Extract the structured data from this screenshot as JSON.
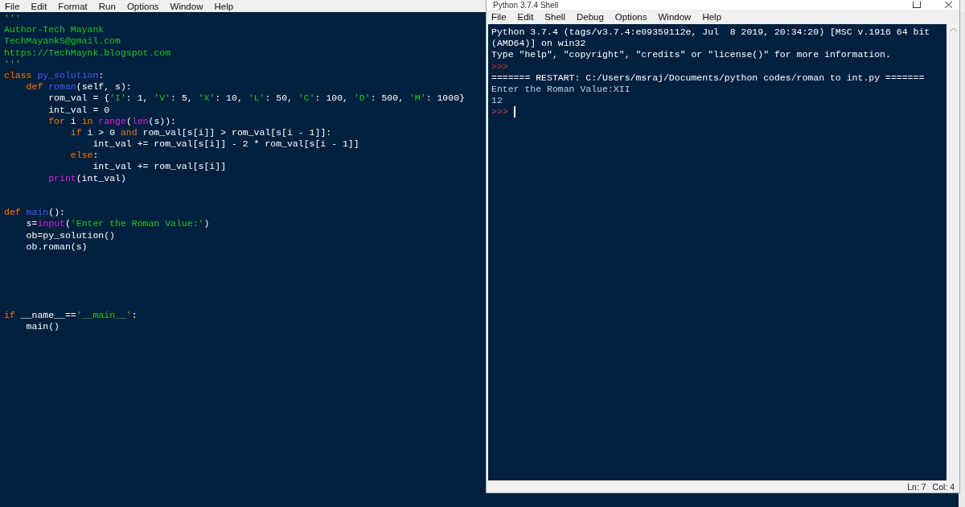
{
  "editor": {
    "menu": [
      "File",
      "Edit",
      "Format",
      "Run",
      "Options",
      "Window",
      "Help"
    ],
    "lines": [
      {
        "kind": "code",
        "tokens": [
          {
            "text": "'''",
            "kind": "string"
          }
        ]
      },
      {
        "kind": "code",
        "tokens": [
          {
            "text": "Author-Tech Mayank",
            "kind": "string"
          }
        ]
      },
      {
        "kind": "code",
        "tokens": [
          {
            "text": "TechMayankS@gmail.com",
            "kind": "string"
          }
        ]
      },
      {
        "kind": "code",
        "tokens": [
          {
            "text": "https://TechMaynk.blogspot.com",
            "kind": "string"
          }
        ]
      },
      {
        "kind": "code",
        "tokens": [
          {
            "text": "'''",
            "kind": "string"
          }
        ]
      },
      {
        "kind": "code",
        "tokens": [
          {
            "text": "class",
            "kind": "keyword"
          },
          {
            "text": " py_solution",
            "kind": "definition"
          },
          {
            "text": ":",
            "kind": "plain"
          }
        ]
      },
      {
        "kind": "code",
        "tokens": [
          {
            "text": "    def",
            "kind": "keyword"
          },
          {
            "text": " roman",
            "kind": "definition"
          },
          {
            "text": "(self, s):",
            "kind": "plain"
          }
        ]
      },
      {
        "kind": "code",
        "tokens": [
          {
            "text": "        rom_val = {",
            "kind": "plain"
          },
          {
            "text": "'I'",
            "kind": "string"
          },
          {
            "text": ": 1, ",
            "kind": "plain"
          },
          {
            "text": "'V'",
            "kind": "string"
          },
          {
            "text": ": 5, ",
            "kind": "plain"
          },
          {
            "text": "'X'",
            "kind": "string"
          },
          {
            "text": ": 10, ",
            "kind": "plain"
          },
          {
            "text": "'L'",
            "kind": "string"
          },
          {
            "text": ": 50, ",
            "kind": "plain"
          },
          {
            "text": "'C'",
            "kind": "string"
          },
          {
            "text": ": 100, ",
            "kind": "plain"
          },
          {
            "text": "'D'",
            "kind": "string"
          },
          {
            "text": ": 500, ",
            "kind": "plain"
          },
          {
            "text": "'M'",
            "kind": "string"
          },
          {
            "text": ": 1000}",
            "kind": "plain"
          }
        ]
      },
      {
        "kind": "code",
        "tokens": [
          {
            "text": "        int_val = 0",
            "kind": "plain"
          }
        ]
      },
      {
        "kind": "code",
        "tokens": [
          {
            "text": "        for",
            "kind": "keyword"
          },
          {
            "text": " i ",
            "kind": "plain"
          },
          {
            "text": "in",
            "kind": "keyword"
          },
          {
            "text": " range",
            "kind": "builtin"
          },
          {
            "text": "(",
            "kind": "plain"
          },
          {
            "text": "len",
            "kind": "builtin"
          },
          {
            "text": "(s)):",
            "kind": "plain"
          }
        ]
      },
      {
        "kind": "code",
        "tokens": [
          {
            "text": "            if",
            "kind": "keyword"
          },
          {
            "text": " i > 0 ",
            "kind": "plain"
          },
          {
            "text": "and",
            "kind": "keyword"
          },
          {
            "text": " rom_val[s[i]] > rom_val[s[i - 1]]:",
            "kind": "plain"
          }
        ]
      },
      {
        "kind": "code",
        "tokens": [
          {
            "text": "                int_val += rom_val[s[i]] - 2 * rom_val[s[i - 1]]",
            "kind": "plain"
          }
        ]
      },
      {
        "kind": "code",
        "tokens": [
          {
            "text": "            else",
            "kind": "keyword"
          },
          {
            "text": ":",
            "kind": "plain"
          }
        ]
      },
      {
        "kind": "code",
        "tokens": [
          {
            "text": "                int_val += rom_val[s[i]]",
            "kind": "plain"
          }
        ]
      },
      {
        "kind": "code",
        "tokens": [
          {
            "text": "        print",
            "kind": "builtin"
          },
          {
            "text": "(int_val)",
            "kind": "plain"
          }
        ]
      },
      {
        "kind": "blank"
      },
      {
        "kind": "blank"
      },
      {
        "kind": "code",
        "tokens": [
          {
            "text": "def",
            "kind": "keyword"
          },
          {
            "text": " main",
            "kind": "definition"
          },
          {
            "text": "():",
            "kind": "plain"
          }
        ]
      },
      {
        "kind": "code",
        "tokens": [
          {
            "text": "    s=",
            "kind": "plain"
          },
          {
            "text": "input",
            "kind": "builtin"
          },
          {
            "text": "(",
            "kind": "plain"
          },
          {
            "text": "'Enter the Roman Value:'",
            "kind": "string"
          },
          {
            "text": ")",
            "kind": "plain"
          }
        ]
      },
      {
        "kind": "code",
        "tokens": [
          {
            "text": "    ob=py_solution()",
            "kind": "plain"
          }
        ]
      },
      {
        "kind": "code",
        "tokens": [
          {
            "text": "    ob.roman(s)",
            "kind": "plain"
          }
        ]
      },
      {
        "kind": "blank"
      },
      {
        "kind": "blank"
      },
      {
        "kind": "blank"
      },
      {
        "kind": "blank"
      },
      {
        "kind": "blank"
      },
      {
        "kind": "code",
        "tokens": [
          {
            "text": "if",
            "kind": "keyword"
          },
          {
            "text": " __name__==",
            "kind": "plain"
          },
          {
            "text": "'__main__'",
            "kind": "string"
          },
          {
            "text": ":",
            "kind": "plain"
          }
        ]
      },
      {
        "kind": "code",
        "tokens": [
          {
            "text": "    main()",
            "kind": "plain"
          }
        ]
      }
    ]
  },
  "shell": {
    "title": "Python 3.7.4 Shell",
    "menu": [
      "File",
      "Edit",
      "Shell",
      "Debug",
      "Options",
      "Window",
      "Help"
    ],
    "lines": [
      {
        "text": "Python 3.7.4 (tags/v3.7.4:e09359112e, Jul  8 2019, 20:34:20) [MSC v.1916 64 bit",
        "kind": "plain",
        "cursor": false
      },
      {
        "text": "(AMD64)] on win32",
        "kind": "plain",
        "cursor": false
      },
      {
        "text": "Type \"help\", \"copyright\", \"credits\" or \"license()\" for more information.",
        "kind": "plain",
        "cursor": false
      },
      {
        "text": ">>>",
        "kind": "prompt",
        "cursor": false
      },
      {
        "text": "======= RESTART: C:/Users/msraj/Documents/python codes/roman to int.py =======",
        "kind": "plain",
        "cursor": false
      },
      {
        "text": "Enter the Roman Value:XII",
        "kind": "output",
        "cursor": false
      },
      {
        "text": "12",
        "kind": "output",
        "cursor": false
      },
      {
        "text": ">>>",
        "kind": "prompt",
        "cursor": true
      }
    ],
    "status": {
      "line": "Ln: 7",
      "column": "Col: 4"
    }
  }
}
